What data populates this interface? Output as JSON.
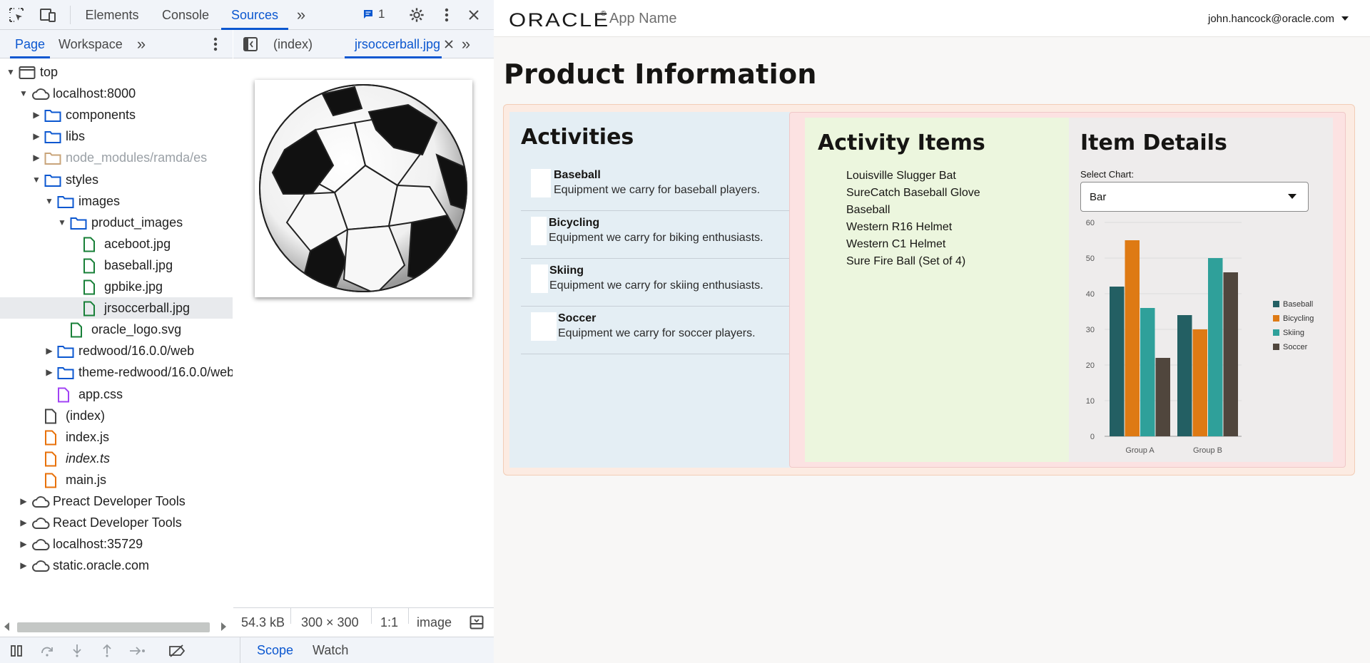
{
  "devtools": {
    "main_tabs": [
      "Elements",
      "Console",
      "Sources"
    ],
    "issues_count": "1",
    "navigator_tabs": [
      "Page",
      "Workspace"
    ],
    "tree": [
      {
        "label": "top",
        "icon": "frame-icon",
        "arrow": "down",
        "level": 0
      },
      {
        "label": "localhost:8000",
        "icon": "cloud-icon",
        "arrow": "down",
        "level": 1
      },
      {
        "label": "components",
        "icon": "folder-icon",
        "arrow": "right",
        "level": 2
      },
      {
        "label": "libs",
        "icon": "folder-icon",
        "arrow": "right",
        "level": 2
      },
      {
        "label": "node_modules/ramda/es",
        "icon": "folder-icon-dim",
        "arrow": "right",
        "level": 2,
        "dim": true
      },
      {
        "label": "styles",
        "icon": "folder-icon",
        "arrow": "down",
        "level": 2
      },
      {
        "label": "images",
        "icon": "folder-icon",
        "arrow": "down",
        "level": 3
      },
      {
        "label": "product_images",
        "icon": "folder-icon",
        "arrow": "down",
        "level": 4
      },
      {
        "label": "aceboot.jpg",
        "icon": "image-file-icon",
        "arrow": "",
        "level": 5
      },
      {
        "label": "baseball.jpg",
        "icon": "image-file-icon",
        "arrow": "",
        "level": 5
      },
      {
        "label": "gpbike.jpg",
        "icon": "image-file-icon",
        "arrow": "",
        "level": 5
      },
      {
        "label": "jrsoccerball.jpg",
        "icon": "image-file-icon",
        "arrow": "",
        "level": 5,
        "selected": true
      },
      {
        "label": "oracle_logo.svg",
        "icon": "image-file-icon",
        "arrow": "",
        "level": 4
      },
      {
        "label": "redwood/16.0.0/web",
        "icon": "folder-icon",
        "arrow": "right",
        "level": 3
      },
      {
        "label": "theme-redwood/16.0.0/web",
        "icon": "folder-icon",
        "arrow": "right",
        "level": 3
      },
      {
        "label": "app.css",
        "icon": "css-file-icon",
        "arrow": "",
        "level": 3
      },
      {
        "label": "(index)",
        "icon": "document-icon",
        "arrow": "",
        "level": 2
      },
      {
        "label": "index.js",
        "icon": "script-file-icon",
        "arrow": "",
        "level": 2
      },
      {
        "label": "index.ts",
        "icon": "script-file-icon",
        "arrow": "",
        "level": 2,
        "italic": true
      },
      {
        "label": "main.js",
        "icon": "script-file-icon",
        "arrow": "",
        "level": 2
      },
      {
        "label": "Preact Developer Tools",
        "icon": "cloud-icon",
        "arrow": "right",
        "level": 1
      },
      {
        "label": "React Developer Tools",
        "icon": "cloud-icon",
        "arrow": "right",
        "level": 1
      },
      {
        "label": "localhost:35729",
        "icon": "cloud-icon",
        "arrow": "right",
        "level": 1
      },
      {
        "label": "static.oracle.com",
        "icon": "cloud-icon",
        "arrow": "right",
        "level": 1
      }
    ],
    "editor_tabs": [
      "(index)",
      "jrsoccerball.jpg"
    ],
    "status": {
      "size": "54.3 kB",
      "dimensions": "300 × 300",
      "ratio": "1:1",
      "mime": "image"
    },
    "debug_tabs": [
      "Scope",
      "Watch"
    ]
  },
  "app": {
    "logo": "ORACLE",
    "app_name": "App Name",
    "user": "john.hancock@oracle.com",
    "page_title": "Product Information",
    "activities_title": "Activities",
    "activities": [
      {
        "name": "Baseball",
        "desc": "Equipment we carry for baseball players."
      },
      {
        "name": "Bicycling",
        "desc": "Equipment we carry for biking enthusiasts."
      },
      {
        "name": "Skiing",
        "desc": "Equipment we carry for skiing enthusiasts."
      },
      {
        "name": "Soccer",
        "desc": "Equipment we carry for soccer players."
      }
    ],
    "items_title": "Activity Items",
    "items": [
      "Louisville Slugger Bat",
      "SureCatch Baseball Glove",
      "Baseball",
      "Western R16 Helmet",
      "Western C1 Helmet",
      "Sure Fire Ball (Set of 4)"
    ],
    "details_title": "Item Details",
    "select_label": "Select Chart:",
    "select_value": "Bar"
  },
  "chart_data": {
    "type": "bar",
    "categories": [
      "Group A",
      "Group B"
    ],
    "series": [
      {
        "name": "Baseball",
        "values": [
          42,
          34
        ],
        "color": "#235f63"
      },
      {
        "name": "Bicycling",
        "values": [
          55,
          30
        ],
        "color": "#de7a14"
      },
      {
        "name": "Skiing",
        "values": [
          36,
          50
        ],
        "color": "#2fa09a"
      },
      {
        "name": "Soccer",
        "values": [
          22,
          46
        ],
        "color": "#50463d"
      }
    ],
    "ylim": [
      0,
      60
    ],
    "yticks": [
      0,
      10,
      20,
      30,
      40,
      50,
      60
    ],
    "legend_position": "right",
    "grid": true
  }
}
